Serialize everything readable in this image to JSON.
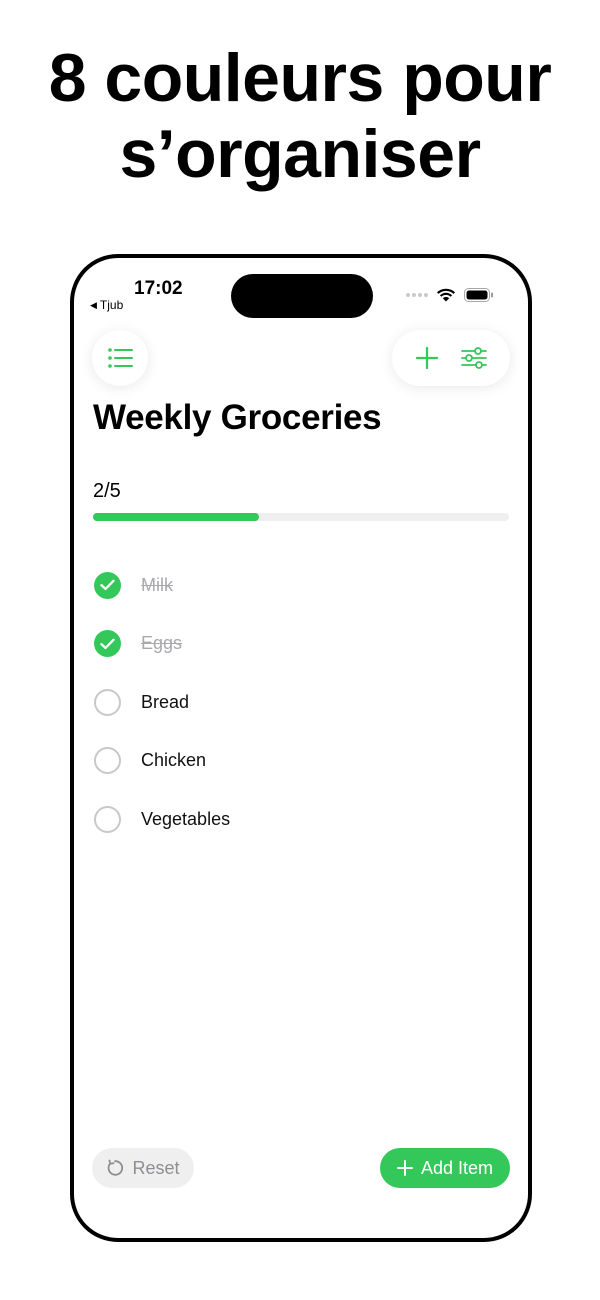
{
  "headline": {
    "line1": "8 couleurs pour",
    "line2": "s’organiser"
  },
  "status_bar": {
    "time": "17:02",
    "back_app": "Tjub"
  },
  "toolbar": {
    "menu_icon": "list-icon",
    "add_icon": "plus-icon",
    "filter_icon": "sliders-icon"
  },
  "list": {
    "title": "Weekly Groceries",
    "progress_text": "2/5",
    "progress": 0.4,
    "items": [
      {
        "label": "Milk",
        "checked": true
      },
      {
        "label": "Eggs",
        "checked": true
      },
      {
        "label": "Bread",
        "checked": false
      },
      {
        "label": "Chicken",
        "checked": false
      },
      {
        "label": "Vegetables",
        "checked": false
      }
    ]
  },
  "footer": {
    "reset_label": "Reset",
    "add_label": "Add Item"
  },
  "colors": {
    "accent": "#34c759",
    "muted": "#8e8e93",
    "track": "#efefef"
  }
}
